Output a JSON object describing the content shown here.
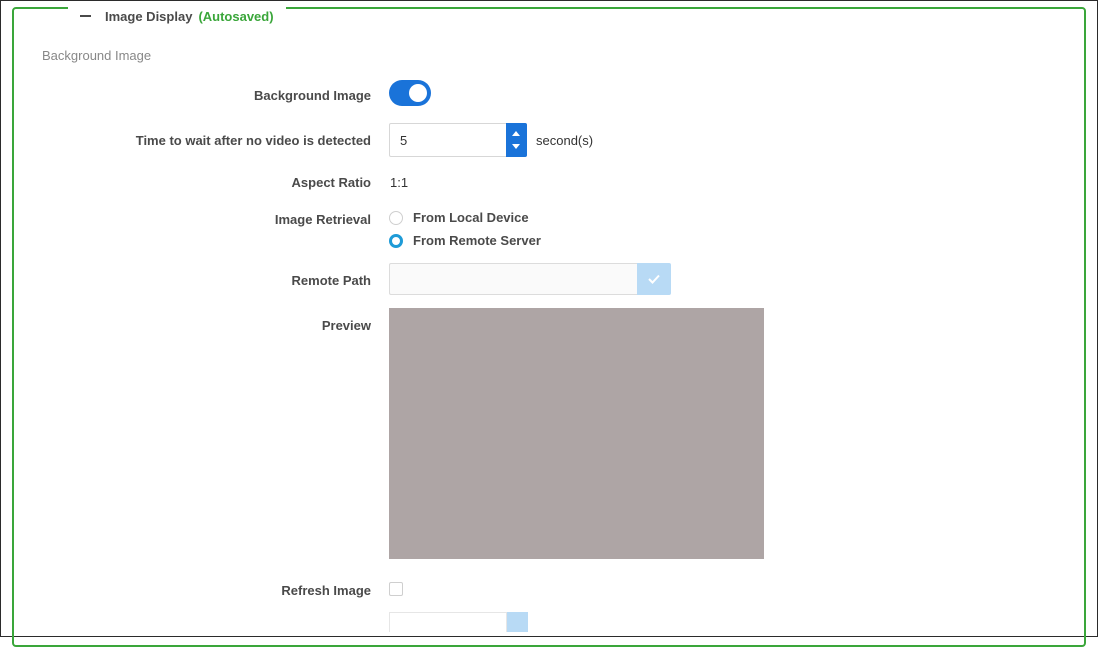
{
  "panel": {
    "title": "Image Display",
    "status": "(Autosaved)",
    "section_title": "Background Image"
  },
  "fields": {
    "background_image": {
      "label": "Background Image",
      "enabled": true
    },
    "wait_time": {
      "label": "Time to wait after no video is detected",
      "value": "5",
      "unit": "second(s)"
    },
    "aspect_ratio": {
      "label": "Aspect Ratio",
      "value": "1:1"
    },
    "image_retrieval": {
      "label": "Image Retrieval",
      "options": [
        "From Local Device",
        "From Remote Server"
      ],
      "selected": "From Remote Server"
    },
    "remote_path": {
      "label": "Remote Path",
      "value": ""
    },
    "preview": {
      "label": "Preview"
    },
    "refresh_image": {
      "label": "Refresh Image",
      "checked": false
    }
  },
  "colors": {
    "accent": "#1a73d9",
    "autosaved": "#3aa63a",
    "frame": "#3aa63a",
    "preview_fill": "#aea5a5",
    "confirm_disabled": "#b8daf5"
  },
  "icons": {
    "collapse": "minus-icon",
    "spinner_up": "caret-up-icon",
    "spinner_down": "caret-down-icon",
    "confirm": "check-icon"
  }
}
